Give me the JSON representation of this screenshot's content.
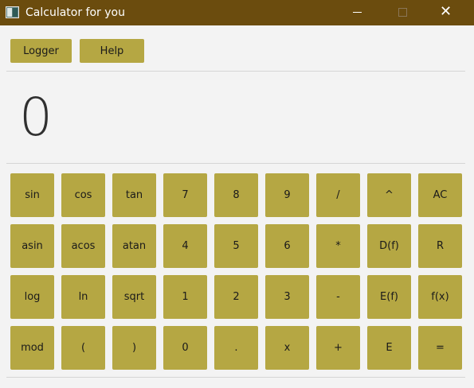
{
  "window": {
    "title": "Calculator for you",
    "icon": "calculator-app-icon",
    "controls": {
      "minimize": "minimize-icon",
      "maximize": "maximize-icon",
      "close": "✕"
    }
  },
  "toolbar": {
    "logger_label": "Logger",
    "help_label": "Help"
  },
  "display": {
    "value": "0"
  },
  "keypad": {
    "keys": [
      "sin",
      "cos",
      "tan",
      "7",
      "8",
      "9",
      "/",
      "^",
      "AC",
      "asin",
      "acos",
      "atan",
      "4",
      "5",
      "6",
      "*",
      "D(f)",
      "R",
      "log",
      "ln",
      "sqrt",
      "1",
      "2",
      "3",
      "-",
      "E(f)",
      "f(x)",
      "mod",
      "(",
      ")",
      "0",
      ".",
      "x",
      "+",
      "E",
      "="
    ]
  },
  "colors": {
    "titlebar": "#6b4c0e",
    "button": "#b5a743",
    "background": "#f3f3f3",
    "display_text": "#303030"
  }
}
